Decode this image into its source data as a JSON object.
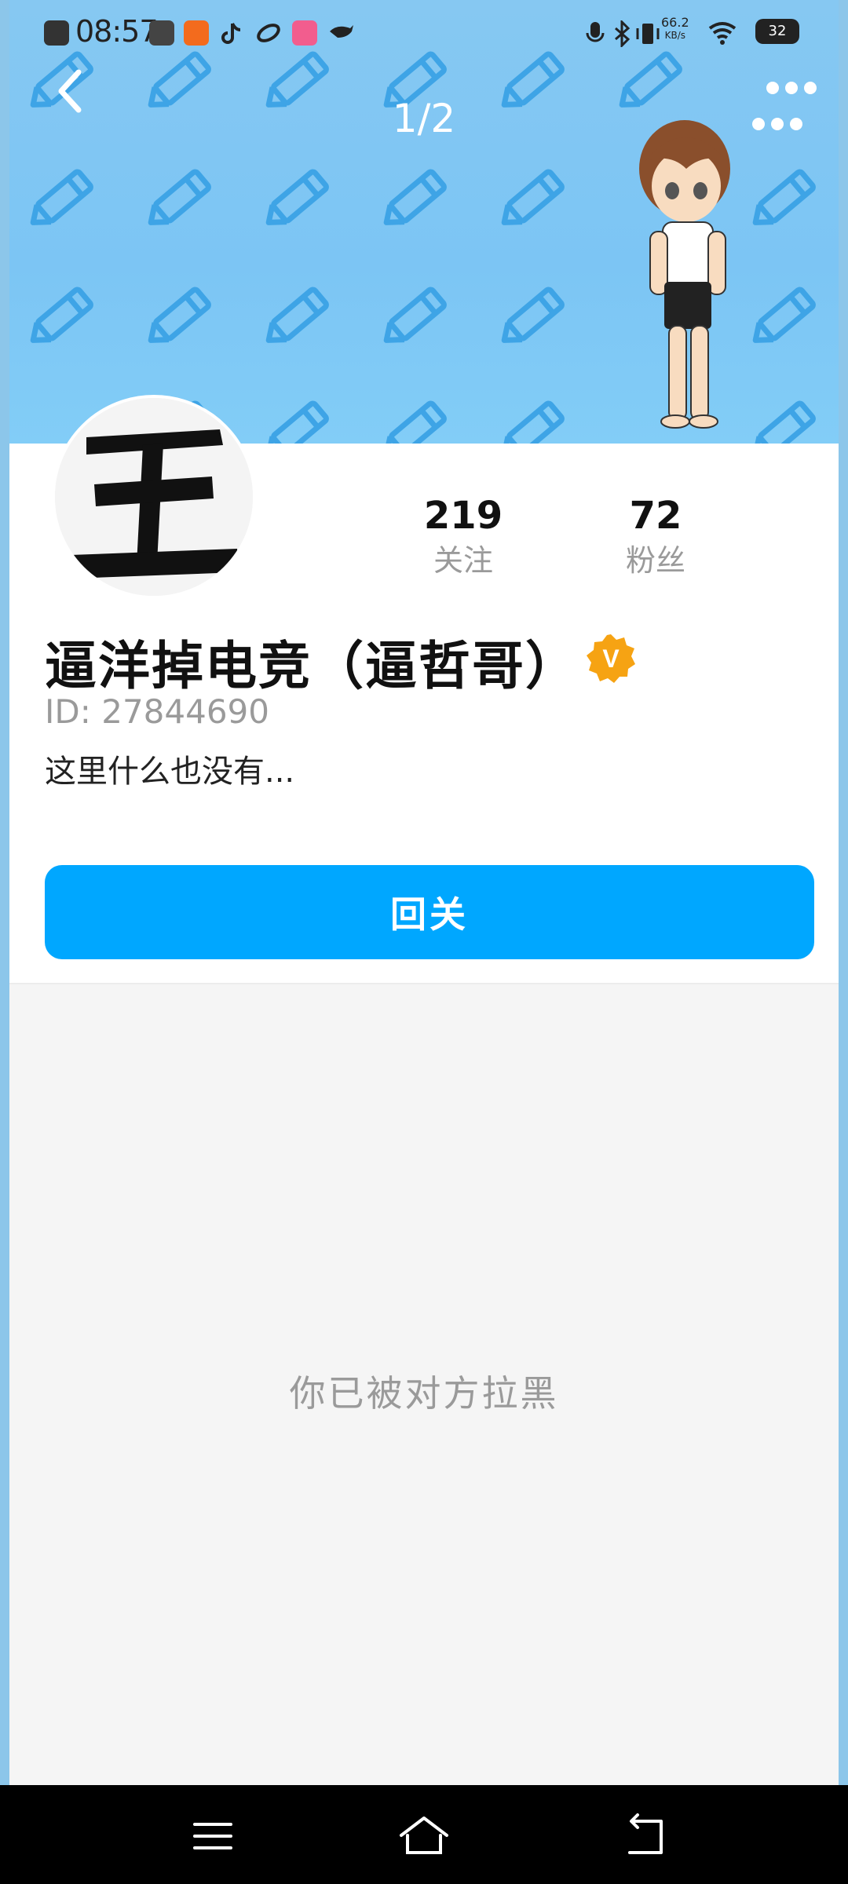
{
  "status_bar": {
    "time": "08:57",
    "network_speed_value": "66.2",
    "network_speed_unit": "KB/s",
    "battery": "32"
  },
  "header": {
    "page_indicator": "1/2"
  },
  "profile": {
    "following_count": "219",
    "following_label": "关注",
    "followers_count": "72",
    "followers_label": "粉丝",
    "name": "逼洋掉电竞（逼哲哥）",
    "badge_letter": "V",
    "user_id": "ID: 27844690",
    "bio": "这里什么也没有...",
    "follow_back_label": "回关"
  },
  "content": {
    "blocked_message": "你已被对方拉黑"
  },
  "colors": {
    "accent": "#00a7ff",
    "header_bg": "#7cc5f4",
    "badge": "#f6a313"
  },
  "icons": {
    "back": "chevron-left-icon",
    "more": "more-dots-icon",
    "nav_menu": "menu-icon",
    "nav_home": "home-icon",
    "nav_back": "back-arrow-icon"
  }
}
